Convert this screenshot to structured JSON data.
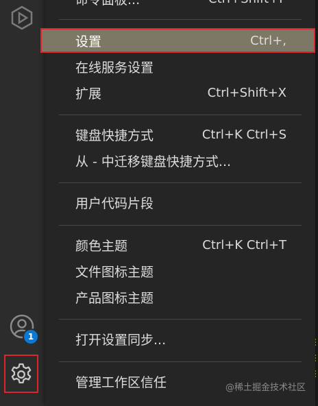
{
  "activity_bar": {
    "account_badge": "1",
    "icons": {
      "remote": "remote-explorer-icon",
      "account": "account-icon",
      "manage": "gear-icon"
    }
  },
  "menu": {
    "top_partial": {
      "label": "命令面板...",
      "shortcut": "Ctrl+Shift+P"
    },
    "items": [
      {
        "label": "设置",
        "shortcut": "Ctrl+,"
      },
      {
        "label": "在线服务设置",
        "shortcut": ""
      },
      {
        "label": "扩展",
        "shortcut": "Ctrl+Shift+X"
      },
      {
        "label": "键盘快捷方式",
        "shortcut": "Ctrl+K Ctrl+S"
      },
      {
        "label": "从 - 中迁移键盘快捷方式...",
        "shortcut": ""
      },
      {
        "label": "用户代码片段",
        "shortcut": ""
      },
      {
        "label": "颜色主题",
        "shortcut": "Ctrl+K Ctrl+T"
      },
      {
        "label": "文件图标主题",
        "shortcut": ""
      },
      {
        "label": "产品图标主题",
        "shortcut": ""
      },
      {
        "label": "打开设置同步...",
        "shortcut": ""
      },
      {
        "label": "管理工作区信任",
        "shortcut": ""
      }
    ]
  },
  "watermark": "@稀土掘金技术社区",
  "colors": {
    "highlight": "#7c7865",
    "annotation": "#e0262d",
    "badge": "#0a78d4"
  }
}
